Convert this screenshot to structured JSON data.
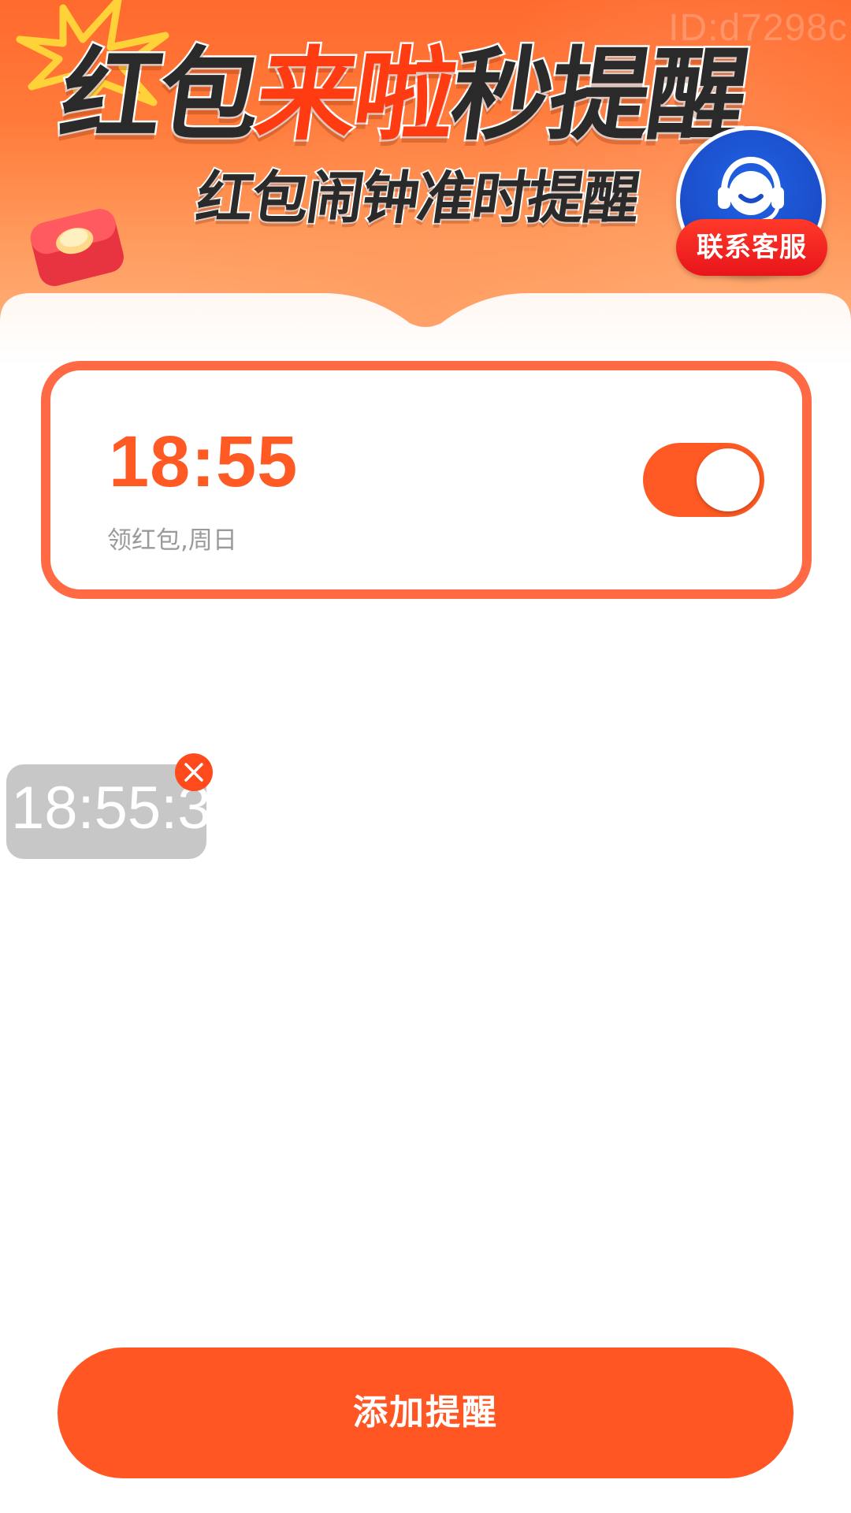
{
  "watermark": "ID:d7298c",
  "banner": {
    "title_part1": "红包",
    "title_part2": "来啦",
    "title_part3": "秒提醒",
    "subtitle": "红包闹钟准时提醒"
  },
  "customer_service": {
    "label": "联系客服",
    "icon": "headset-agent-icon"
  },
  "alarms": [
    {
      "time": "18:55",
      "description": "领红包,周日",
      "enabled": true
    }
  ],
  "floating_clock": {
    "time_text": "18:55:3",
    "close_icon": "close-icon"
  },
  "actions": {
    "add_label": "添加提醒"
  },
  "colors": {
    "accent": "#ff5624",
    "card_border": "#ff6a45",
    "cs_blue": "#1f63e6",
    "cs_red": "#e8141a"
  }
}
